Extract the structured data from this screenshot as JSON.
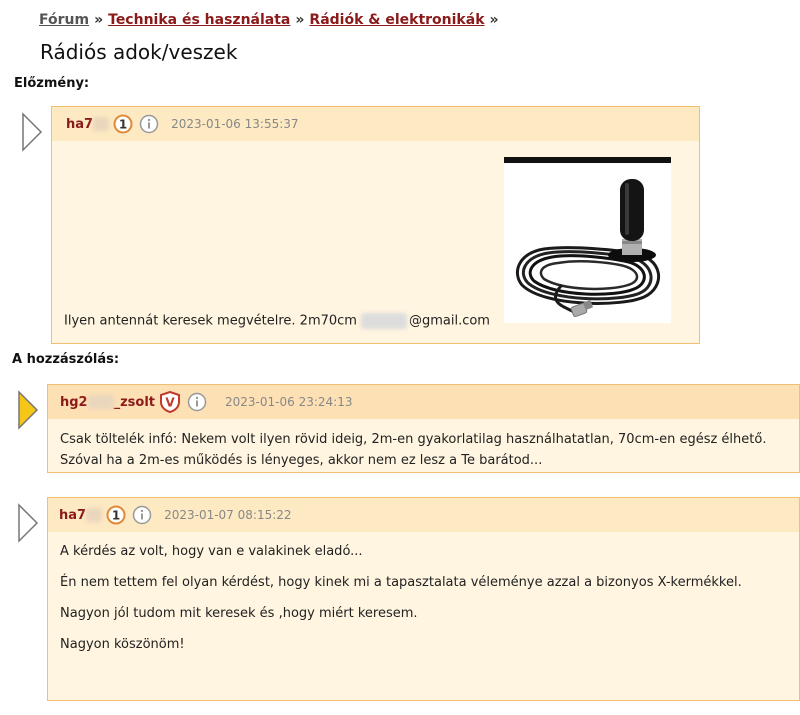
{
  "breadcrumb": {
    "forum": "Fórum",
    "category": "Technika és használata",
    "subcategory": "Rádiók & elektronikák",
    "separator": "»"
  },
  "page_title": "Rádiós adok/veszek",
  "sections": {
    "history_label": "Előzmény:",
    "reply_label": "A hozzászólás:"
  },
  "posts": [
    {
      "username_visible": "ha7",
      "timestamp": "2023-01-06 13:55:37",
      "badge": "1",
      "body_text": "Ilyen antennát keresek megvételre. 2m70cm",
      "email_suffix": "@gmail.com"
    },
    {
      "username_prefix": "hg2",
      "username_suffix": "_zsolt",
      "badge": "V",
      "timestamp": "2023-01-06 23:24:13",
      "lines": [
        "Csak töltelék infó: Nekem volt ilyen rövid ideig, 2m-en gyakorlatilag használhatatlan, 70cm-en egész élhető.",
        "Szóval ha a 2m-es működés is lényeges, akkor nem ez lesz a Te barátod..."
      ]
    },
    {
      "username_visible": "ha7",
      "badge": "1",
      "timestamp": "2023-01-07 08:15:22",
      "paragraphs": [
        "A kérdés az volt, hogy van e valakinek eladó...",
        "Én nem tettem fel olyan kérdést, hogy kinek mi a tapasztalata véleménye azzal a bizonyos X-kermékkel.",
        "Nagyon jól tudom mit keresek és ,hogy miért keresem.",
        "Nagyon köszönöm!"
      ]
    }
  ],
  "colors": {
    "link": "#8b1a1a",
    "post_bg": "#fff5e0",
    "post_header_bg": "#fde9c2",
    "post_border": "#f0c070",
    "active_arrow": "#f5c518"
  }
}
